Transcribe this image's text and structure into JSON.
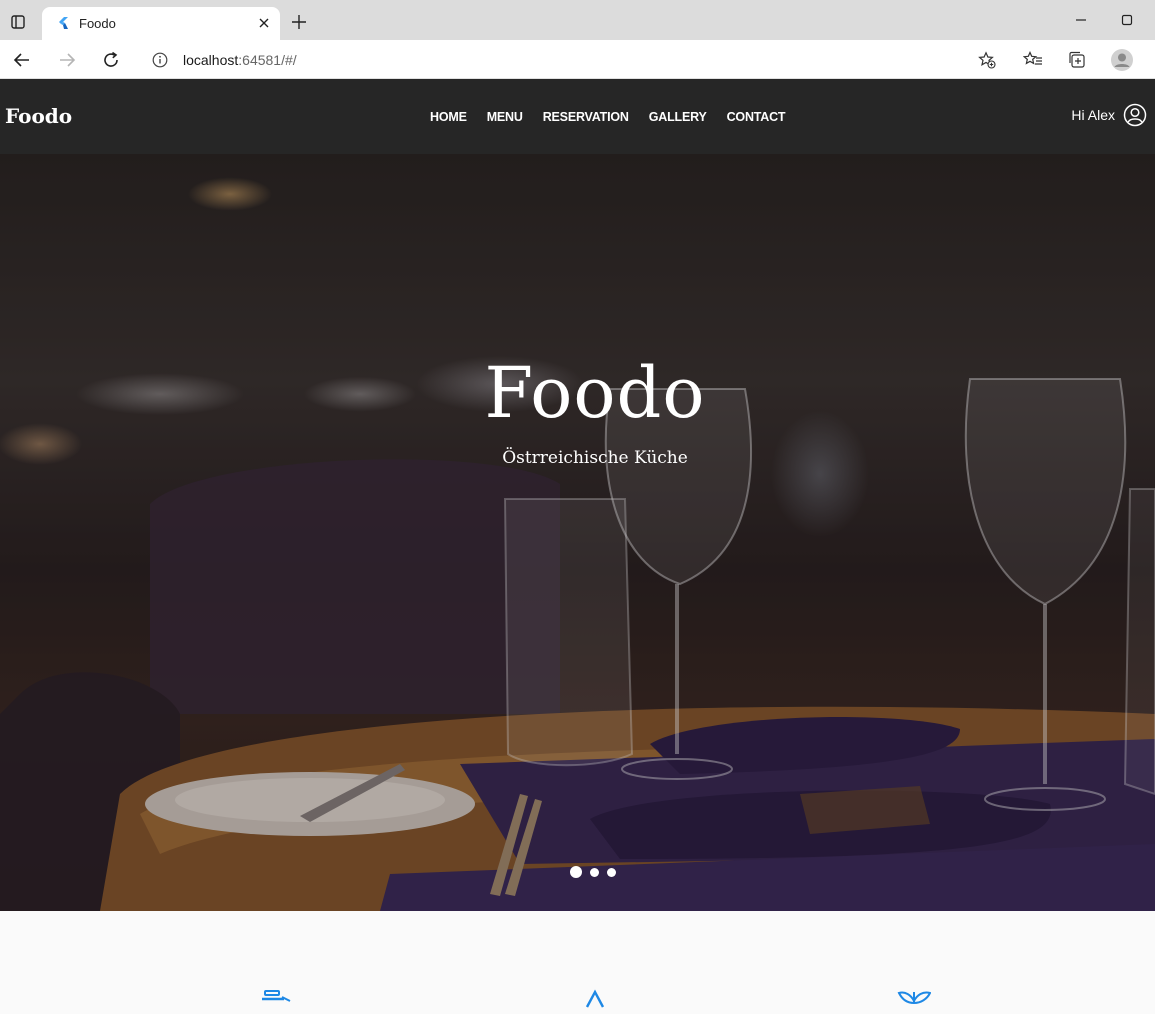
{
  "browser": {
    "tab": {
      "title": "Foodo"
    },
    "address": {
      "host": "localhost",
      "path": ":64581/#/"
    }
  },
  "site": {
    "logo": "Foodo",
    "nav": [
      "HOME",
      "MENU",
      "RESERVATION",
      "GALLERY",
      "CONTACT"
    ],
    "user_greeting": "Hi Alex"
  },
  "hero": {
    "title": "Foodo",
    "subtitle": "Östrreichische Küche",
    "slides": {
      "count": 3,
      "active_index": 1
    }
  },
  "colors": {
    "header_bg": "#262626",
    "accent_icon": "#1e88e5",
    "hero_text": "#ffffff"
  },
  "icons": {
    "browser": [
      "tab-actions-icon",
      "flutter-icon",
      "close-icon",
      "plus-icon",
      "minimize-icon",
      "maximize-icon",
      "back-arrow-icon",
      "forward-arrow-icon",
      "reload-icon",
      "info-icon",
      "star-plus-icon",
      "favorites-icon",
      "collections-icon",
      "profile-icon"
    ],
    "site": [
      "user-circle-icon",
      "dish-icon",
      "chef-hat-icon",
      "leaf-icon"
    ]
  }
}
